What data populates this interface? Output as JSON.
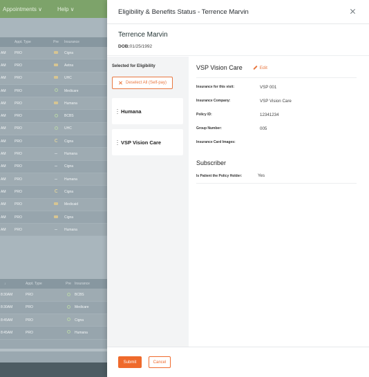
{
  "background": {
    "nav": [
      "Appointments ∨",
      "Help ∨"
    ],
    "table1": {
      "headers": [
        "",
        "Appt. Type",
        "Pre",
        "Insurance"
      ],
      "rows": [
        {
          "time": "AM",
          "type": "PRO",
          "status": "card-icon",
          "insurance": "Cigna"
        },
        {
          "time": "AM",
          "type": "PRO",
          "status": "card-icon",
          "insurance": "Aetna"
        },
        {
          "time": "AM",
          "type": "PRO",
          "status": "card-icon",
          "insurance": "UHC"
        },
        {
          "time": "AM",
          "type": "PRO",
          "status": "check-icon",
          "insurance": "Medicare"
        },
        {
          "time": "AM",
          "type": "PRO",
          "status": "card-icon",
          "insurance": "Humana"
        },
        {
          "time": "AM",
          "type": "PRO",
          "status": "check-icon",
          "insurance": "BCBS"
        },
        {
          "time": "AM",
          "type": "PRO",
          "status": "check-icon",
          "insurance": "UHC"
        },
        {
          "time": "AM",
          "type": "PRO",
          "status": "pending-icon",
          "insurance": "Cigna"
        },
        {
          "time": "AM",
          "type": "PRO",
          "status": "dash-icon",
          "insurance": "Humana"
        },
        {
          "time": "AM",
          "type": "PRO",
          "status": "dash-icon",
          "insurance": "Cigna"
        },
        {
          "time": "AM",
          "type": "PRO",
          "status": "dash-icon",
          "insurance": "Humana"
        },
        {
          "time": "AM",
          "type": "PRO",
          "status": "pending-icon",
          "insurance": "Cigna"
        },
        {
          "time": "AM",
          "type": "PRO",
          "status": "card-icon",
          "insurance": "Medicaid"
        },
        {
          "time": "AM",
          "type": "PRO",
          "status": "card-icon",
          "insurance": "Cigna"
        },
        {
          "time": "AM",
          "type": "PRO",
          "status": "dash-icon",
          "insurance": "Humana"
        }
      ]
    },
    "table2": {
      "headers": [
        "↓",
        "Appt. Type",
        "Pre",
        "Insurance"
      ],
      "rows": [
        {
          "time": "8:30AM",
          "type": "PRO",
          "status": "check-icon",
          "insurance": "BCBS"
        },
        {
          "time": "8:30AM",
          "type": "PRO",
          "status": "check-icon",
          "insurance": "Medicare"
        },
        {
          "time": "8:45AM",
          "type": "PRO",
          "status": "check-icon",
          "insurance": "Cigna"
        },
        {
          "time": "8:45AM",
          "type": "PRO",
          "status": "check-icon",
          "insurance": "Humana"
        }
      ]
    }
  },
  "modal": {
    "title": "Eligibility & Benefits Status - Terrence Marvin",
    "patient_name": "Terrence Marvin",
    "dob_label": "DOB:",
    "dob_value": "01/25/1992",
    "selected_label": "Selected for Eligibility",
    "deselect_label": "Deselect All (Self-pay)",
    "insurances": [
      "Humana",
      "VSP Vision Care"
    ],
    "detail": {
      "title": "VSP Vision Care",
      "edit_label": "Edit",
      "fields": [
        {
          "label": "Insurance for this visit:",
          "value": "VSP 001"
        },
        {
          "label": "Insurance Company:",
          "value": "VSP Vision Care"
        },
        {
          "label": "Policy ID:",
          "value": "12341234"
        },
        {
          "label": "Group Number:",
          "value": "005"
        },
        {
          "label": "Insurance Card Images:",
          "value": ""
        }
      ],
      "subscriber_title": "Subscriber",
      "subscriber_fields": [
        {
          "label": "Is Patient the Policy Holder:",
          "value": "Yes"
        }
      ]
    },
    "submit_label": "Submit",
    "cancel_label": "Cancel"
  },
  "colors": {
    "accent": "#ef6a2c",
    "overlay": "#9aa8b0"
  }
}
